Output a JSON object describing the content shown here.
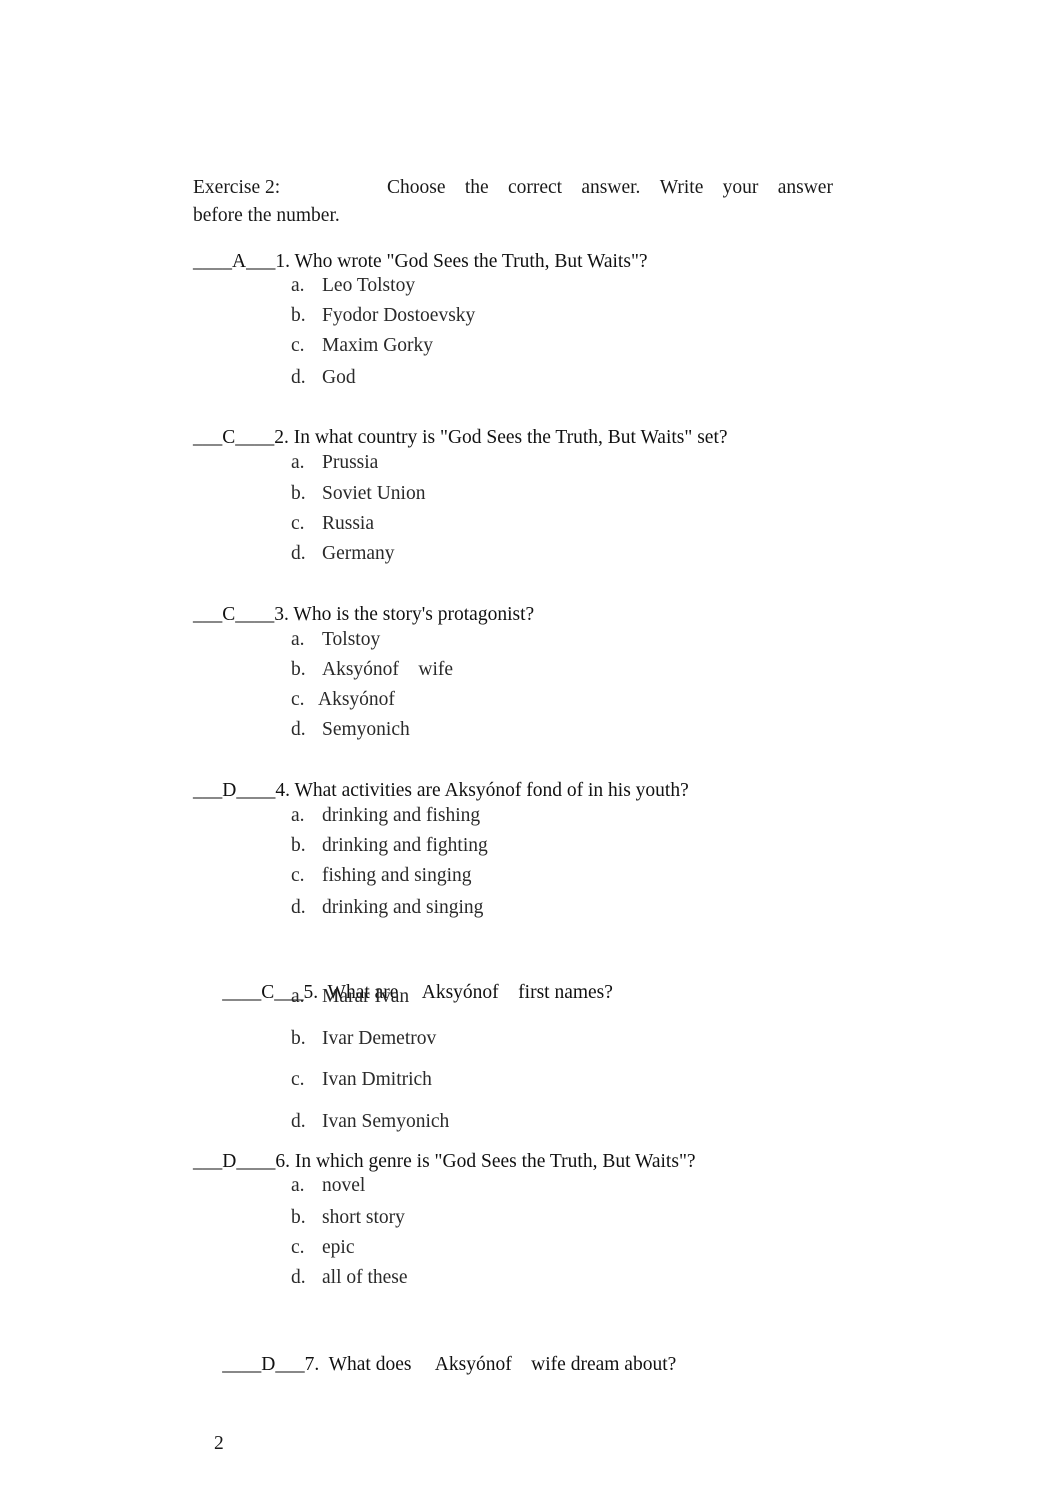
{
  "exercise": {
    "label": "Exercise 2:",
    "instruction_words": [
      "Choose",
      "the",
      "correct",
      "answer.",
      "Write",
      "your",
      "answer"
    ],
    "instruction_line2": "before the number."
  },
  "questions": [
    {
      "blank_before": "____",
      "answer": "A",
      "blank_after": "___",
      "number": "1.",
      "text": "Who wrote \"God Sees the Truth, But Waits\"?",
      "options": [
        {
          "letter": "a.",
          "text": "Leo Tolstoy"
        },
        {
          "letter": "b.",
          "text": "Fyodor Dostoevsky"
        },
        {
          "letter": "c.",
          "text": "Maxim Gorky"
        },
        {
          "letter": "d.",
          "text": "God"
        }
      ]
    },
    {
      "blank_before": "___",
      "answer": "C",
      "blank_after": "____",
      "number": "2.",
      "text": "In what country is \"God Sees the Truth, But Waits\" set?",
      "options": [
        {
          "letter": "a.",
          "text": "Prussia"
        },
        {
          "letter": "b.",
          "text": "Soviet Union"
        },
        {
          "letter": "c.",
          "text": "Russia"
        },
        {
          "letter": "d.",
          "text": "Germany"
        }
      ]
    },
    {
      "blank_before": "___",
      "answer": "C",
      "blank_after": "____",
      "number": "3.",
      "text": "Who is the story's protagonist?",
      "options": [
        {
          "letter": "a.",
          "text": "Tolstoy"
        },
        {
          "letter": "b.",
          "text": "Aksyónof    wife"
        },
        {
          "letter": "c.",
          "text": "Aksyónof"
        },
        {
          "letter": "d.",
          "text": "Semyonich"
        }
      ]
    },
    {
      "blank_before": "___",
      "answer": "D",
      "blank_after": "____",
      "number": "4.",
      "text": "What activities are Aksyónof fond of in his youth?",
      "options": [
        {
          "letter": "a.",
          "text": "drinking and fishing"
        },
        {
          "letter": "b.",
          "text": "drinking and fighting"
        },
        {
          "letter": "c.",
          "text": "fishing and singing"
        },
        {
          "letter": "d.",
          "text": "drinking and singing"
        }
      ]
    },
    {
      "blank_before": "____",
      "answer": "C",
      "blank_after": "___",
      "number": "5.",
      "text": "What are     Aksyónof    first names?",
      "options": [
        {
          "letter": "a.",
          "text": "Marar Ivan"
        },
        {
          "letter": "b.",
          "text": "Ivar Demetrov"
        },
        {
          "letter": "c.",
          "text": "Ivan Dmitrich"
        },
        {
          "letter": "d.",
          "text": "Ivan Semyonich"
        }
      ]
    },
    {
      "blank_before": "___",
      "answer": "D",
      "blank_after": "____",
      "number": "6.",
      "text": "In which genre is \"God Sees the Truth, But Waits\"?",
      "options": [
        {
          "letter": "a.",
          "text": "novel"
        },
        {
          "letter": "b.",
          "text": "short story"
        },
        {
          "letter": "c.",
          "text": "epic"
        },
        {
          "letter": "d.",
          "text": "all of these"
        }
      ]
    },
    {
      "blank_before": "____",
      "answer": "D",
      "blank_after": "___",
      "number": "7.",
      "text": "What does     Aksyónof    wife dream about?",
      "options": []
    }
  ],
  "page_number": "2"
}
